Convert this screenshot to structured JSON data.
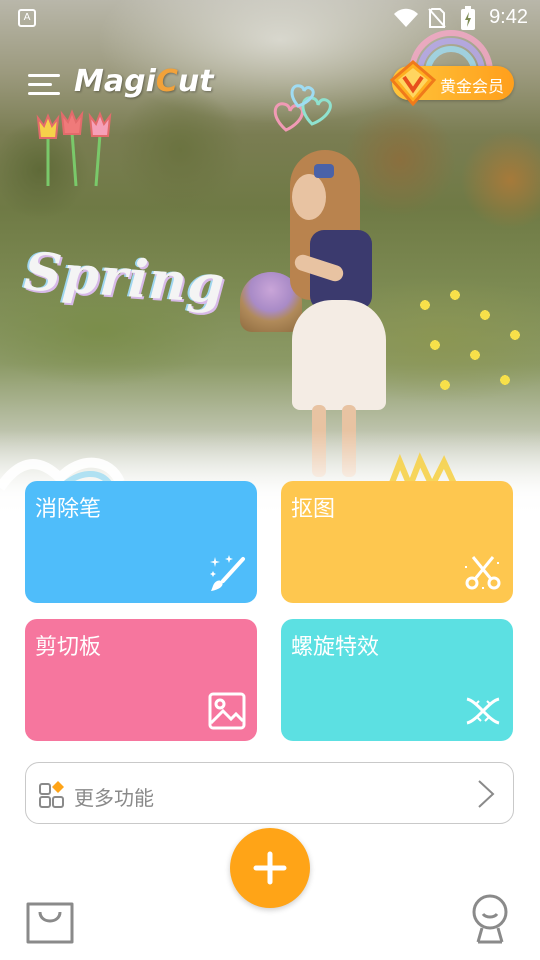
{
  "status_bar": {
    "notification_icon": "app-notification-icon",
    "notification_glyph": "A",
    "time": "9:42",
    "icons": [
      "wifi-icon",
      "no-sim-icon",
      "battery-charging-icon"
    ]
  },
  "header": {
    "menu_icon": "hamburger-menu-icon",
    "logo_part1": "Magi",
    "logo_accent": "C",
    "logo_part2": "ut",
    "vip_icon": "vip-diamond-icon",
    "vip_label": "黄金会员"
  },
  "hero": {
    "doodle_text": "Spring"
  },
  "features": [
    {
      "label": "消除笔",
      "icon": "magic-brush-icon",
      "color": "#4fbdfa"
    },
    {
      "label": "抠图",
      "icon": "scissors-icon",
      "color": "#fec74f"
    },
    {
      "label": "剪切板",
      "icon": "image-icon",
      "color": "#f6769e"
    },
    {
      "label": "螺旋特效",
      "icon": "dna-spiral-icon",
      "color": "#5ce0e2"
    }
  ],
  "more": {
    "icon": "apps-grid-icon",
    "label": "更多功能",
    "chevron": "chevron-right-icon"
  },
  "bottom_nav": {
    "left_icon": "shopping-bag-icon",
    "center_icon": "plus-icon",
    "right_icon": "profile-icon",
    "accent_color": "#ffa417"
  }
}
